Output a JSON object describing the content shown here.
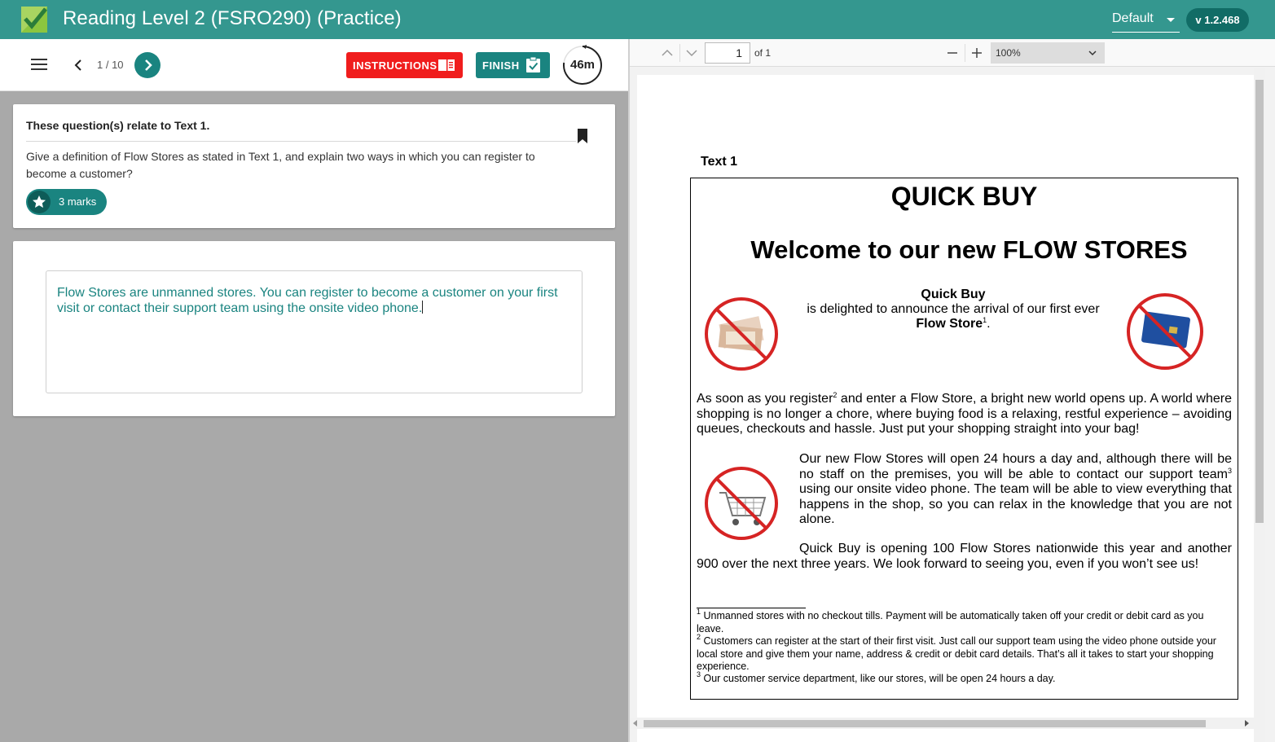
{
  "header": {
    "title": "Reading Level 2 (FSRO290) (Practice)",
    "profile": "Default",
    "version": "v 1.2.468"
  },
  "toolbar": {
    "page_current": "1",
    "page_total": "10",
    "instructions_label": "INSTRUCTIONS",
    "finish_label": "FINISH",
    "timer": "46m"
  },
  "question": {
    "header": "These question(s) relate to Text 1.",
    "text": "Give a definition of Flow Stores as stated in Text 1, and explain two ways in which you can register to become a customer?",
    "marks": "3 marks"
  },
  "answer": {
    "text": "Flow Stores are unmanned stores. You can register to become a customer on your first visit or contact their support team using the onsite video phone."
  },
  "pdf": {
    "page_input": "1",
    "page_of": "of 1",
    "zoom": "100%",
    "document": {
      "label": "Text 1",
      "title": "QUICK BUY",
      "welcome": "Welcome to our new FLOW STORES",
      "intro_line1": "Quick Buy",
      "intro_line2": "is delighted to announce the arrival of our first ever",
      "intro_line3": "Flow Store",
      "p1_a": "As soon as you register",
      "p1_b": " and enter a Flow Store, a bright new world opens up.  A world where shopping is no longer a chore, where buying food is a relaxing, restful experience – avoiding queues, checkouts and hassle. Just put your shopping straight into your bag!",
      "p2_a": "Our new Flow Stores will open 24 hours a day and, although there will be no staff on the premises, you will be able to contact our support team",
      "p2_b": " using our onsite video phone. The team will be able to view everything that happens in the shop, so you can relax in the knowledge that you are not alone.",
      "p3": "Quick Buy is opening 100 Flow Stores nationwide this year and another 900 over the next three years. We look forward to seeing you, even if you won’t see us!",
      "fn1": "Unmanned stores with no checkout tills. Payment will be automatically taken off your credit or debit card as you leave.",
      "fn2": "Customers can register at the start of their first visit. Just call our support team using the video phone outside your local store and give them your name, address & credit or debit card details. That’s all it takes to start your shopping experience.",
      "fn3": "Our customer service department, like our stores, will be open 24 hours a day."
    }
  },
  "colors": {
    "header": "#34978f",
    "accent": "#1a8480",
    "instructions": "#f01d1d",
    "badge": "#116c66"
  }
}
